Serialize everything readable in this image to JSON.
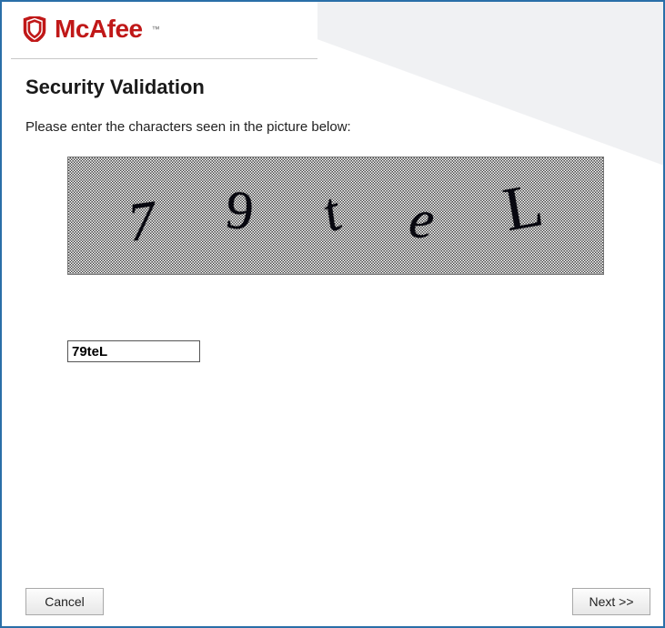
{
  "brand": {
    "name": "McAfee",
    "color": "#c01818"
  },
  "page": {
    "title": "Security Validation",
    "instruction": "Please enter the characters seen in the picture below:"
  },
  "captcha": {
    "chars": [
      "7",
      "9",
      "t",
      "e",
      "L"
    ],
    "display": "79teL",
    "input_value": "79teL",
    "input_placeholder": ""
  },
  "buttons": {
    "cancel": "Cancel",
    "next": "Next >>"
  }
}
